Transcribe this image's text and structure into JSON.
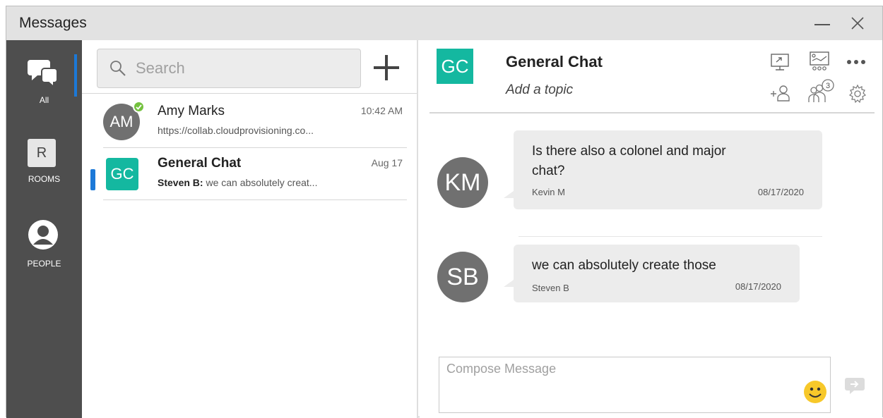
{
  "window": {
    "title": "Messages",
    "minimize_icon": "minimize-icon",
    "close_icon": "close-icon"
  },
  "rail": {
    "items": [
      {
        "id": "all",
        "label": "All",
        "icon": "chat-bubbles-icon",
        "active": true
      },
      {
        "id": "rooms",
        "label": "ROOMS",
        "icon_letter": "R"
      },
      {
        "id": "people",
        "label": "PEOPLE",
        "icon": "person-icon"
      }
    ],
    "accent_color": "#1c79d8"
  },
  "search": {
    "placeholder": "Search",
    "icon": "search-icon",
    "add_icon": "plus-icon"
  },
  "conversations": [
    {
      "initials": "AM",
      "name": "Amy Marks",
      "time": "10:42 AM",
      "snippet": "https://collab.cloudprovisioning.co...",
      "presence": "available",
      "presence_color": "#74c13f"
    },
    {
      "initials": "GC",
      "name": "General Chat",
      "time": "Aug 17",
      "snippet_author": "Steven B",
      "snippet_sep": ":",
      "snippet": " we can absolutely creat...",
      "selected": true,
      "avatar_color": "#14b8a0"
    }
  ],
  "chat": {
    "initials": "GC",
    "title": "General Chat",
    "topic": "Add a topic",
    "header_icons": [
      "screen-share-icon",
      "whiteboard-icon",
      "more-icon",
      "add-person-icon",
      "participants-icon",
      "settings-icon"
    ],
    "participant_count": "3",
    "messages": [
      {
        "initials": "KM",
        "text_line1": "Is there also a colonel and major",
        "text_line2": "chat?",
        "author": "Kevin M",
        "date": "08/17/2020"
      },
      {
        "initials": "SB",
        "text_line1": "we can absolutely create those",
        "author": "Steven B",
        "date": "08/17/2020"
      }
    ],
    "compose_placeholder": "Compose Message",
    "emoji_icon": "smiley-icon",
    "send_icon": "send-icon"
  }
}
